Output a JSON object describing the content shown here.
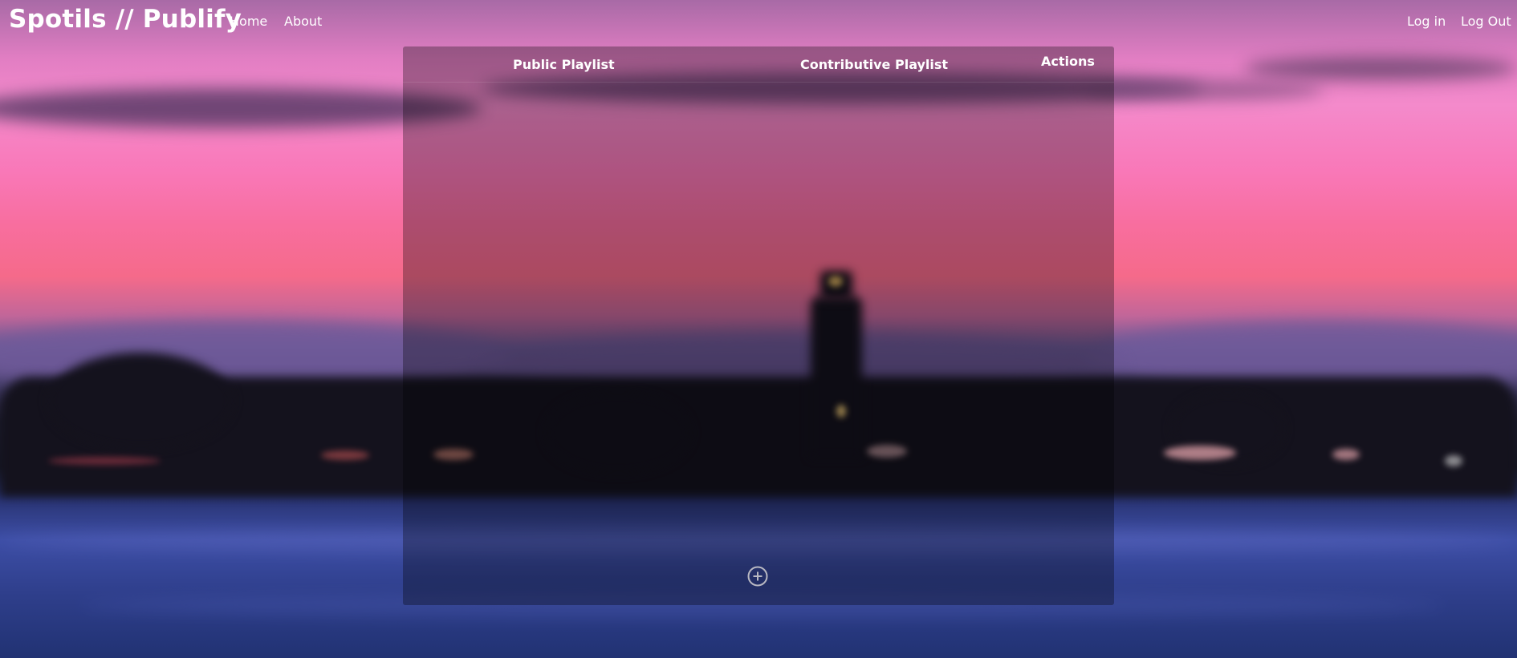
{
  "header": {
    "brand": "Spotils // Publify",
    "nav": {
      "home": "Home",
      "about": "About"
    },
    "auth": {
      "login": "Log in",
      "logout": "Log Out"
    }
  },
  "table": {
    "columns": {
      "public": "Public Playlist",
      "contributive": "Contributive Playlist",
      "actions": "Actions"
    },
    "rows": []
  },
  "icons": {
    "add": "plus-circle-icon"
  },
  "colors": {
    "text": "#ffffff",
    "panel_overlay": "rgba(0,0,0,0.30)"
  }
}
